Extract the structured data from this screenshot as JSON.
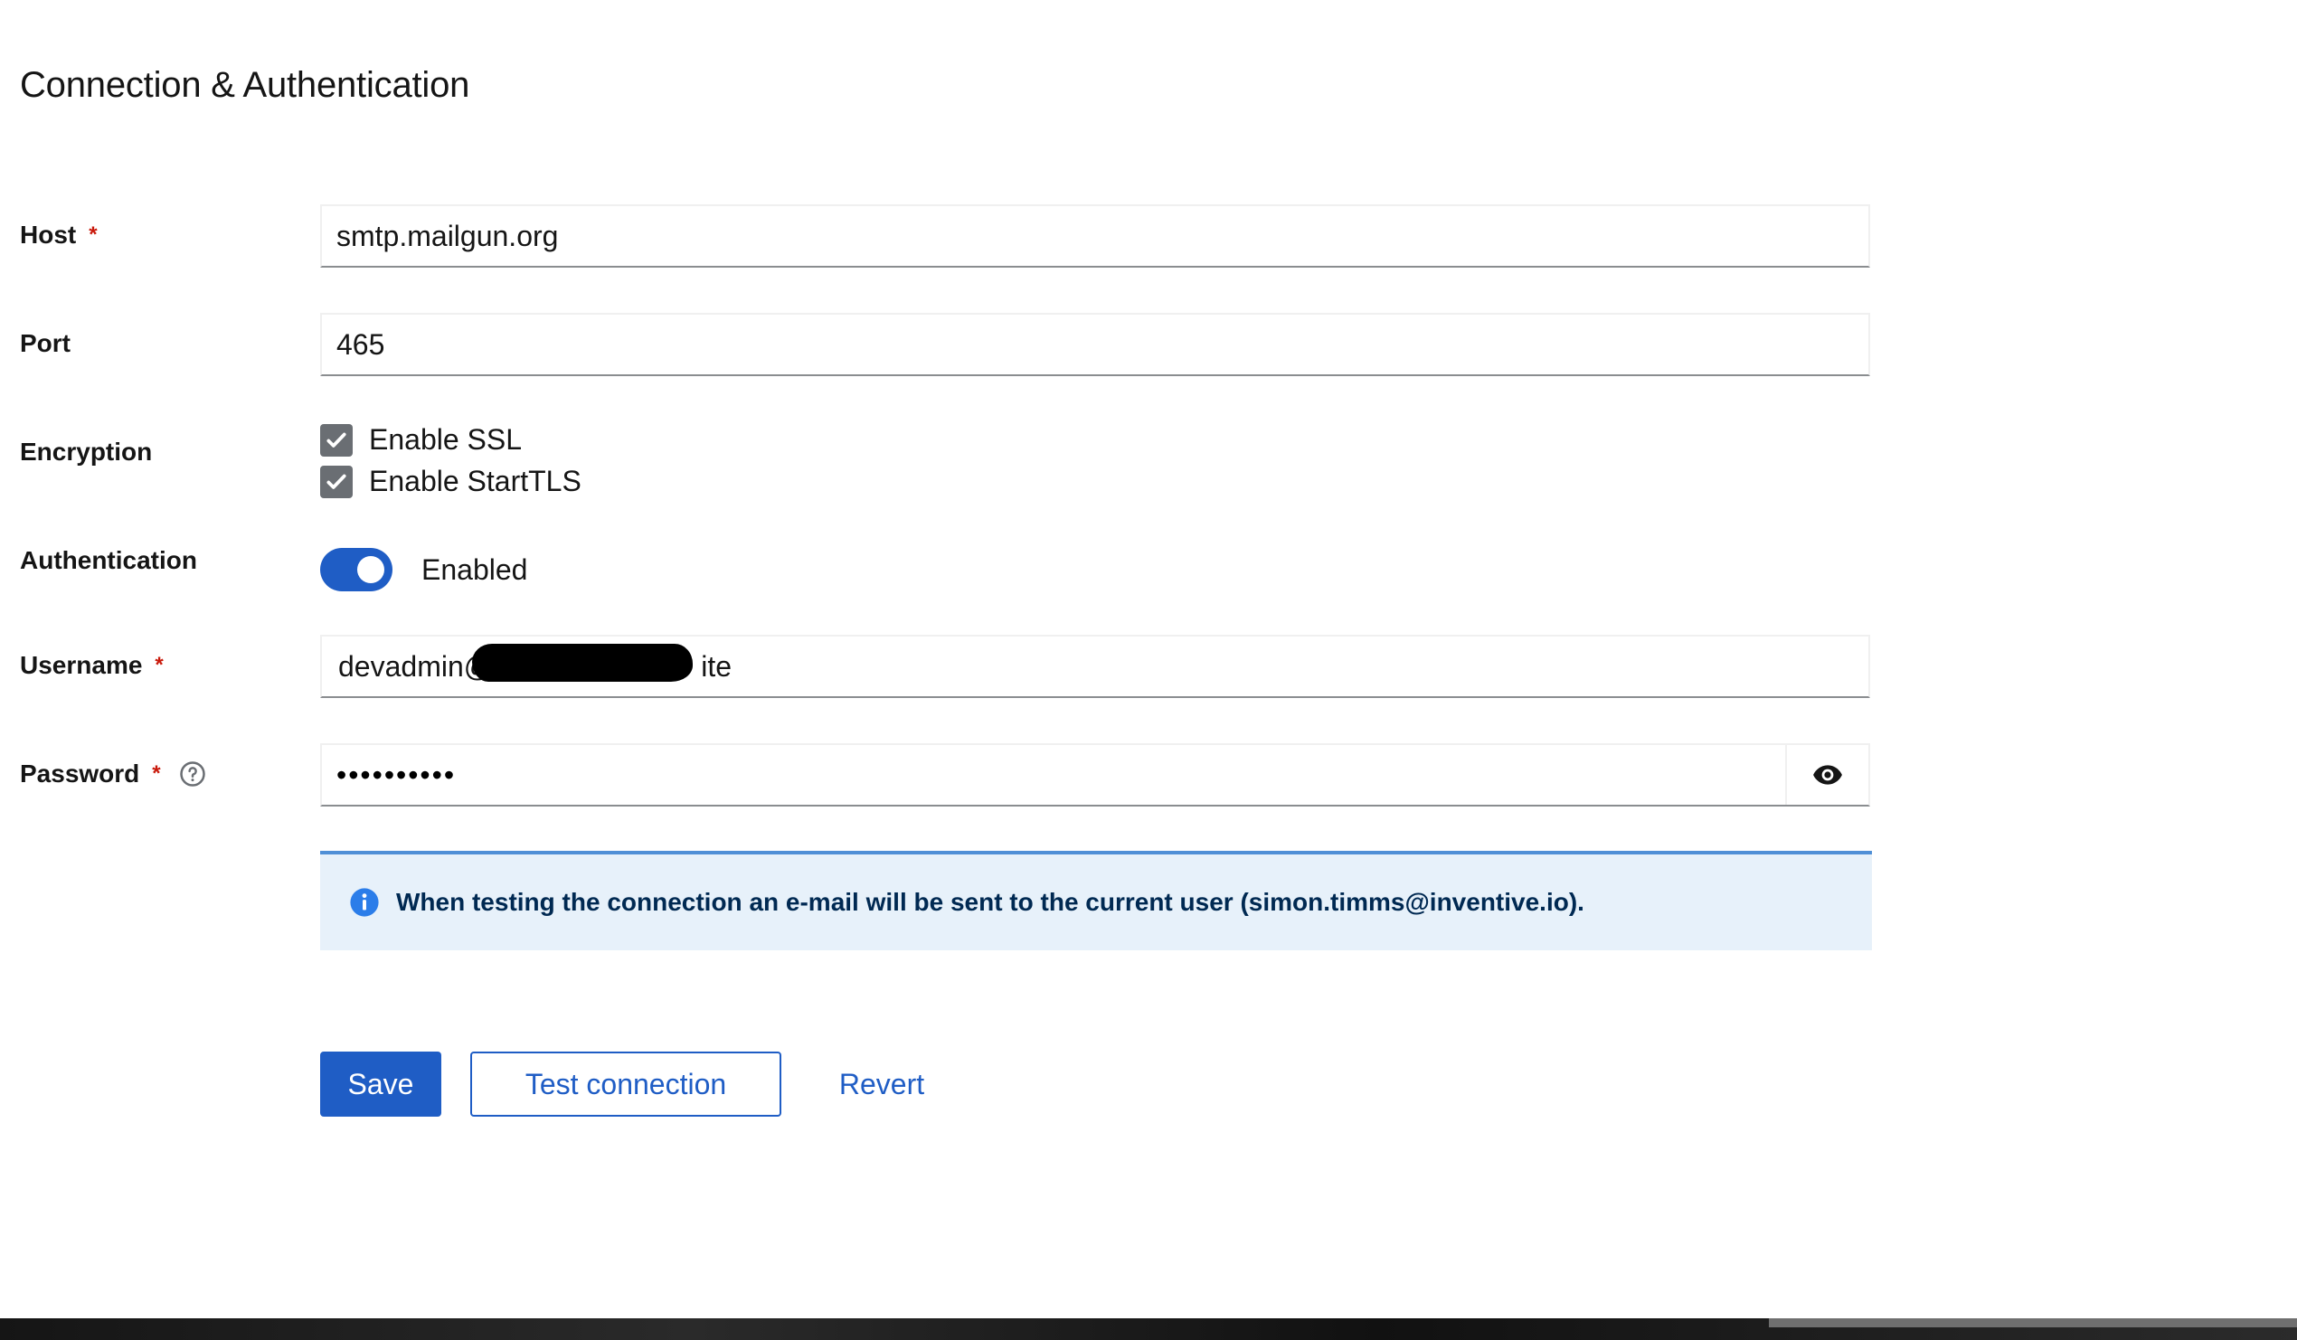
{
  "section": {
    "title": "Connection & Authentication"
  },
  "fields": {
    "host": {
      "label": "Host",
      "required_mark": "*",
      "value": "smtp.mailgun.org"
    },
    "port": {
      "label": "Port",
      "value": "465"
    },
    "encryption": {
      "label": "Encryption",
      "options": [
        {
          "label": "Enable SSL",
          "checked": true
        },
        {
          "label": "Enable StartTLS",
          "checked": true
        }
      ]
    },
    "authentication": {
      "label": "Authentication",
      "state_label": "Enabled",
      "enabled": true
    },
    "username": {
      "label": "Username",
      "required_mark": "*",
      "value_prefix": "devadmin@",
      "value_suffix": "ite"
    },
    "password": {
      "label": "Password",
      "required_mark": "*",
      "value": "••••••••••"
    }
  },
  "alert": {
    "text": "When testing the connection an e-mail will be sent to the current user (simon.timms@inventive.io)."
  },
  "actions": {
    "save": "Save",
    "test": "Test connection",
    "revert": "Revert"
  },
  "colors": {
    "primary": "#1f5dc5",
    "required": "#c9190b",
    "alert_bg": "#e7f1fa",
    "alert_border": "#4f8fd6",
    "checkbox": "#6a6e73"
  }
}
